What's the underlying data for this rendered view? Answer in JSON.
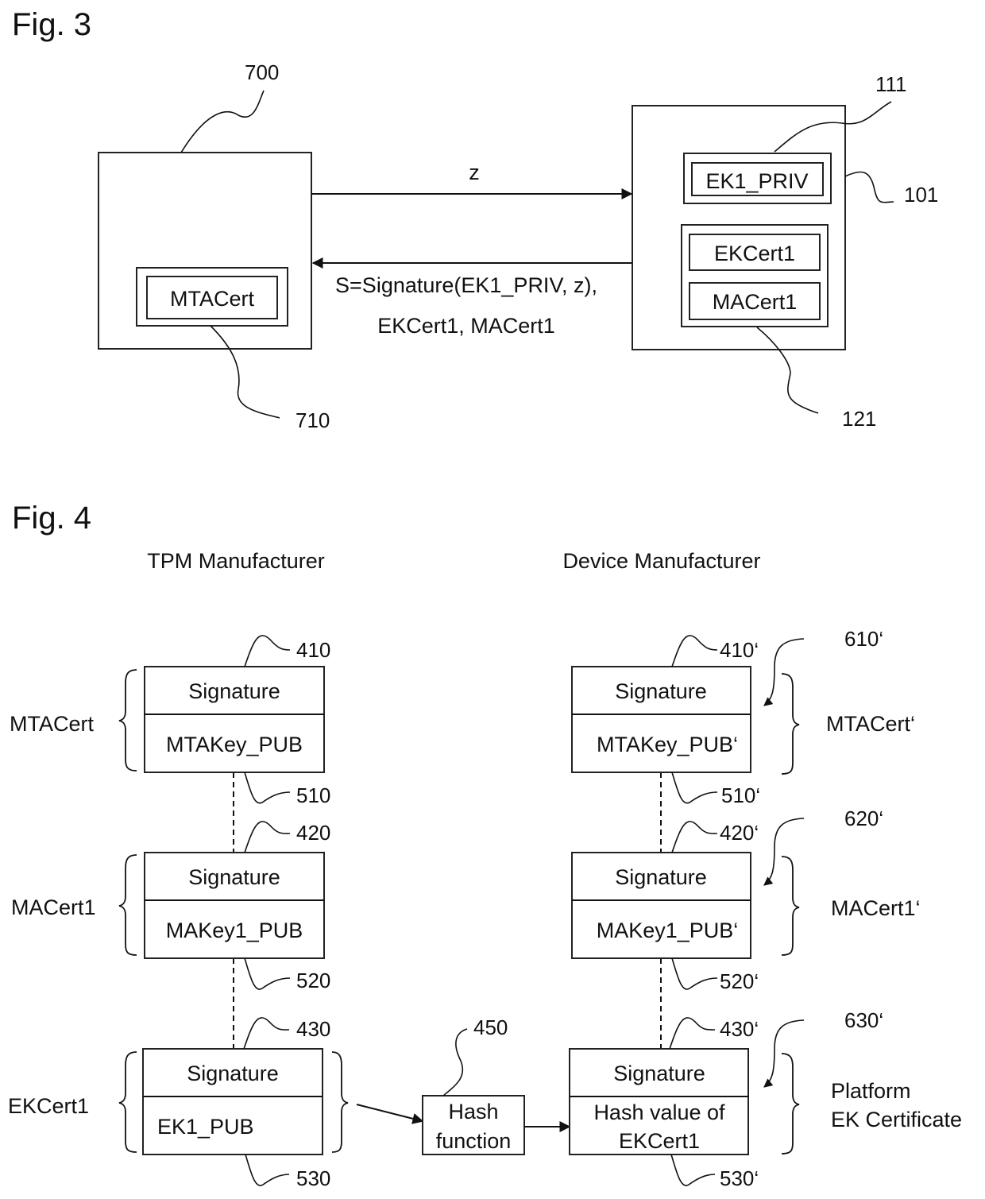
{
  "fig3": {
    "title": "Fig. 3",
    "left_entity": {
      "ref": "700",
      "inner": {
        "label": "MTACert",
        "ref": "710"
      }
    },
    "right_entity": {
      "ref": "101",
      "key_store": {
        "label": "EK1_PRIV",
        "ref": "111"
      },
      "cert_store": {
        "ref": "121",
        "items": [
          "EKCert1",
          "MACert1"
        ]
      }
    },
    "messages": {
      "forward": "z",
      "reply_line1": "S=Signature(EK1_PRIV, z),",
      "reply_line2": "EKCert1, MACert1"
    }
  },
  "fig4": {
    "title": "Fig. 4",
    "columns": {
      "left": "TPM Manufacturer",
      "right": "Device Manufacturer"
    },
    "left_chain": [
      {
        "name": "MTACert",
        "top": "Signature",
        "bottom": "MTAKey_PUB",
        "ref_top": "410",
        "ref_bottom": "510"
      },
      {
        "name": "MACert1",
        "top": "Signature",
        "bottom": "MAKey1_PUB",
        "ref_top": "420",
        "ref_bottom": "520"
      },
      {
        "name": "EKCert1",
        "top": "Signature",
        "bottom": "EK1_PUB",
        "ref_top": "430",
        "ref_bottom": "530"
      }
    ],
    "hash": {
      "line1": "Hash",
      "line2": "function",
      "ref": "450"
    },
    "right_chain": [
      {
        "name": "MTACert‘",
        "top": "Signature",
        "bottom": "MTAKey_PUB‘",
        "ref_top": "410‘",
        "ref_bottom": "510‘",
        "ref_sig": "610‘"
      },
      {
        "name": "MACert1‘",
        "top": "Signature",
        "bottom": "MAKey1_PUB‘",
        "ref_top": "420‘",
        "ref_bottom": "520‘",
        "ref_sig": "620‘"
      },
      {
        "name_line1": "Platform",
        "name_line2": "EK Certificate",
        "top": "Signature",
        "bottom_line1": "Hash value of",
        "bottom_line2": "EKCert1",
        "ref_top": "430‘",
        "ref_bottom": "530‘",
        "ref_sig": "630‘"
      }
    ]
  }
}
